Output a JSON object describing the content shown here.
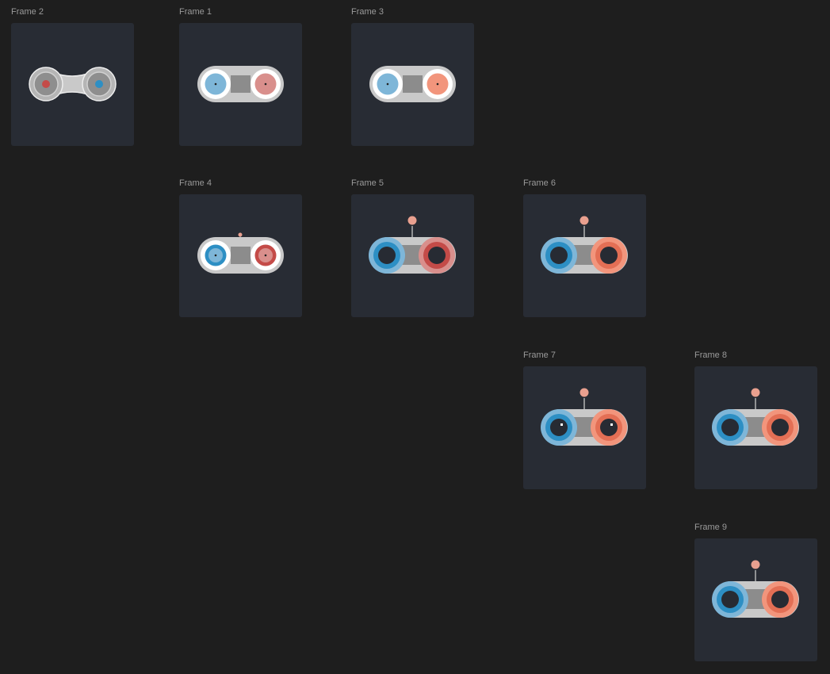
{
  "colors": {
    "canvas_bg": "#1e1e1e",
    "frame_bg": "#282c34",
    "label": "#9a9a9a",
    "body_gray": "#c9c9c9",
    "center_dark": "#8c8c8c",
    "blue_dark": "#2d8fc4",
    "blue_light": "#7eb6d8",
    "red_dark": "#c44b48",
    "red_light": "#d98f8c",
    "salmon": "#f2957c",
    "coral": "#e36f55",
    "pupil": "#272b33",
    "antenna_tip": "#e9a08f"
  },
  "frames": [
    {
      "id": "frame-2",
      "label": "Frame 2",
      "variant": "v2"
    },
    {
      "id": "frame-1",
      "label": "Frame 1",
      "variant": "v1"
    },
    {
      "id": "frame-3",
      "label": "Frame 3",
      "variant": "v3"
    },
    {
      "id": "frame-4",
      "label": "Frame 4",
      "variant": "v4"
    },
    {
      "id": "frame-5",
      "label": "Frame 5",
      "variant": "v5"
    },
    {
      "id": "frame-6",
      "label": "Frame 6",
      "variant": "v6"
    },
    {
      "id": "frame-7",
      "label": "Frame 7",
      "variant": "v7"
    },
    {
      "id": "frame-8",
      "label": "Frame 8",
      "variant": "v6"
    },
    {
      "id": "frame-9",
      "label": "Frame 9",
      "variant": "v6"
    }
  ]
}
